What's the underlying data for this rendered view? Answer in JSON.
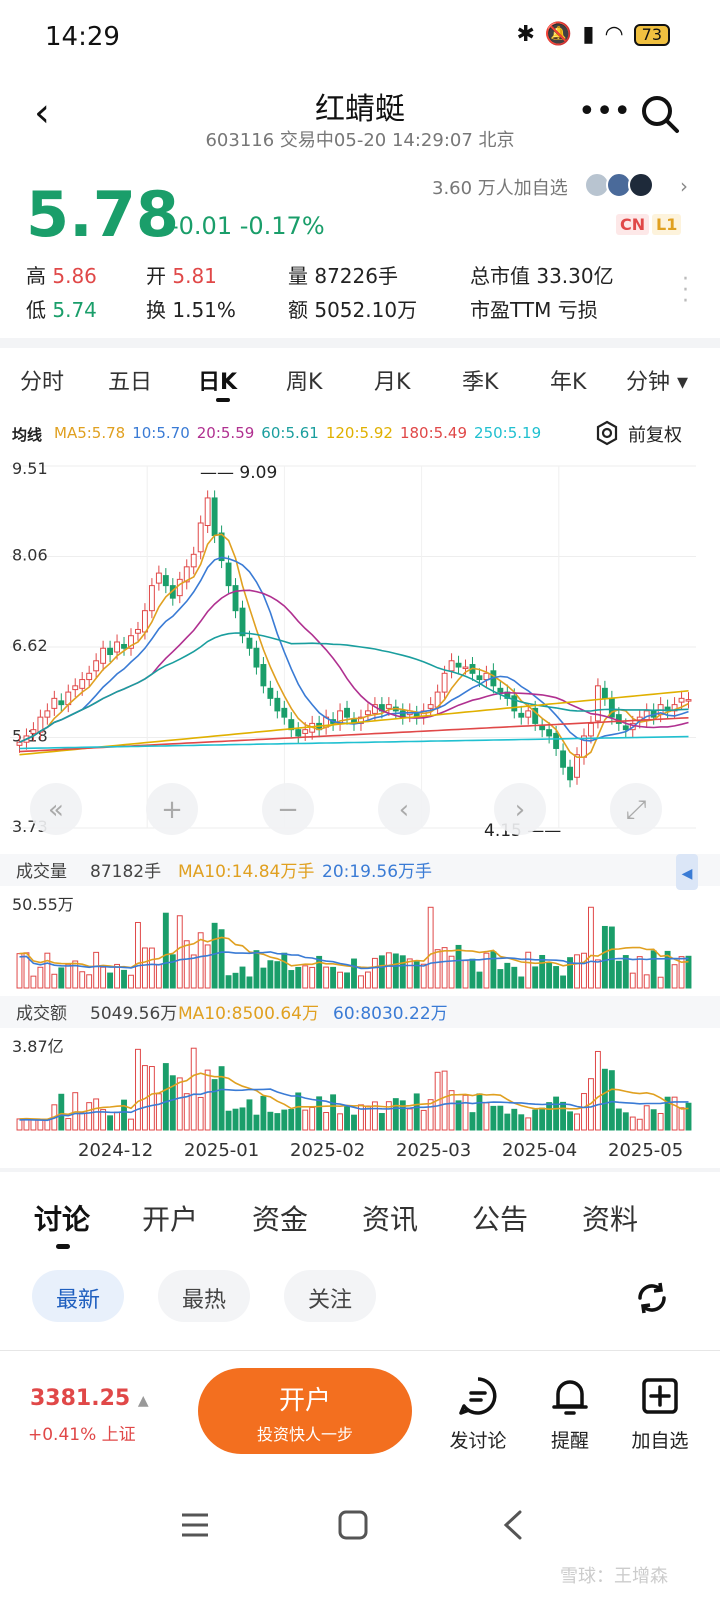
{
  "status_bar": {
    "time": "14:29",
    "battery": "73"
  },
  "header": {
    "title": "红蜻蜓",
    "subtitle": "603116 交易中05-20 14:29:07 北京"
  },
  "quote": {
    "price": "5.78",
    "change": "-0.01 -0.17%",
    "watchers": "3.60 万人加自选",
    "tags": [
      "CN",
      "L1"
    ],
    "stats": {
      "high_label": "高",
      "high": "5.86",
      "open_label": "开",
      "open": "5.81",
      "volume_label": "量",
      "volume": "87226手",
      "mktcap_label": "总市值",
      "mktcap": "33.30亿",
      "low_label": "低",
      "low": "5.74",
      "turnover_label": "换",
      "turnover": "1.51%",
      "amount_label": "额",
      "amount": "5052.10万",
      "pe_label": "市盈TTM",
      "pe": "亏损"
    }
  },
  "period_tabs": [
    "分时",
    "五日",
    "日K",
    "周K",
    "月K",
    "季K",
    "年K",
    "分钟"
  ],
  "ma_line": {
    "label": "均线",
    "items": [
      {
        "text": "MA5:5.78",
        "color": "#e0a020"
      },
      {
        "text": "10:5.70",
        "color": "#3a7bd5"
      },
      {
        "text": "20:5.59",
        "color": "#b03090"
      },
      {
        "text": "60:5.61",
        "color": "#1a9e9e"
      },
      {
        "text": "120:5.92",
        "color": "#e0b000"
      },
      {
        "text": "180:5.49",
        "color": "#e04848"
      },
      {
        "text": "250:5.19",
        "color": "#20c0d0"
      }
    ],
    "adjust_label": "前复权"
  },
  "colors": {
    "up": "#e04848",
    "down": "#1a9e6a",
    "accent": "#f36f1f",
    "blue": "#1f5fbf"
  },
  "chart_data": [
    {
      "type": "candlestick",
      "title": "",
      "y_ticks": [
        "9.51",
        "8.06",
        "6.62",
        "5.18",
        "3.73"
      ],
      "ylim": [
        3.73,
        9.51
      ],
      "x_ticks": [
        "2024-12",
        "2025-01",
        "2025-02",
        "2025-03",
        "2025-04",
        "2025-05"
      ],
      "annotations": {
        "max": "9.09",
        "min": "4.15"
      },
      "close_series": [
        5.1,
        5.2,
        5.3,
        5.5,
        5.6,
        5.8,
        5.7,
        5.9,
        6.0,
        6.1,
        6.2,
        6.4,
        6.6,
        6.5,
        6.7,
        6.6,
        6.8,
        6.9,
        7.2,
        7.6,
        7.8,
        7.6,
        7.4,
        7.7,
        7.9,
        8.1,
        8.6,
        9.0,
        8.4,
        8.0,
        7.6,
        7.2,
        6.8,
        6.6,
        6.3,
        6.0,
        5.8,
        5.6,
        5.5,
        5.3,
        5.2,
        5.3,
        5.4,
        5.3,
        5.5,
        5.4,
        5.6,
        5.5,
        5.4,
        5.5,
        5.6,
        5.7,
        5.6,
        5.7,
        5.6,
        5.5,
        5.6,
        5.5,
        5.6,
        5.7,
        5.9,
        6.2,
        6.4,
        6.3,
        6.3,
        6.2,
        6.1,
        6.2,
        6.0,
        5.9,
        5.8,
        5.6,
        5.5,
        5.6,
        5.4,
        5.3,
        5.2,
        5.0,
        4.7,
        4.5,
        4.9,
        5.2,
        5.4,
        6.0,
        5.8,
        5.5,
        5.4,
        5.3,
        5.4,
        5.5,
        5.6,
        5.5,
        5.7,
        5.6,
        5.7,
        5.8,
        5.78
      ]
    },
    {
      "type": "bar",
      "title": "成交量",
      "values_label": "87182手",
      "ma_labels": [
        {
          "text": "MA10:14.84万手",
          "color": "#e0a020"
        },
        {
          "text": "20:19.56万手",
          "color": "#3a7bd5"
        }
      ],
      "ymax_label": "50.55万"
    },
    {
      "type": "bar",
      "title": "成交额",
      "values_label": "5049.56万",
      "ma_labels": [
        {
          "text": "MA10:8500.64万",
          "color": "#e0a020"
        },
        {
          "text": "60:8030.22万",
          "color": "#3a7bd5"
        }
      ],
      "ymax_label": "3.87亿"
    }
  ],
  "bottom_tabs": [
    "讨论",
    "开户",
    "资金",
    "资讯",
    "公告",
    "资料"
  ],
  "filter_pills": [
    "最新",
    "最热",
    "关注"
  ],
  "footer": {
    "index_value": "3381.25",
    "index_change": "+0.41% 上证",
    "open_title": "开户",
    "open_sub": "投资快人一步",
    "actions": [
      "发讨论",
      "提醒",
      "加自选"
    ]
  },
  "watermark": "雪球：王增森"
}
